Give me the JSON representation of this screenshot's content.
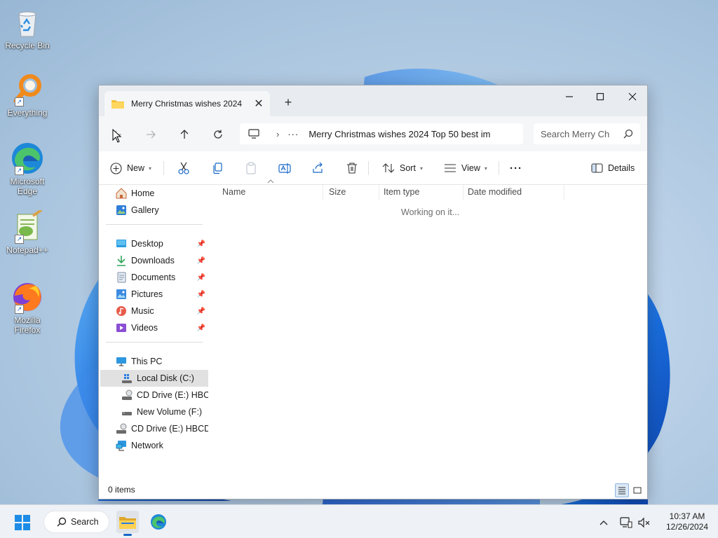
{
  "desktop": {
    "icons": [
      {
        "label": "Recycle Bin",
        "icon": "recycle-bin-icon"
      },
      {
        "label": "Everything",
        "icon": "everything-icon"
      },
      {
        "label": "Microsoft Edge",
        "icon": "edge-icon"
      },
      {
        "label": "Notepad++",
        "icon": "notepadpp-icon"
      },
      {
        "label": "Mozilla Firefox",
        "icon": "firefox-icon"
      }
    ]
  },
  "window": {
    "tab_title": "Merry Christmas wishes 2024",
    "new_tab_glyph": "+",
    "close_tab_glyph": "✕",
    "address": {
      "overflow": "···",
      "separator": "›",
      "path_visible": "Merry Christmas wishes 2024  Top 50 best im"
    },
    "search_placeholder": "Search Merry Ch",
    "commands": {
      "new": "New",
      "sort": "Sort",
      "view": "View",
      "more": "···",
      "details": "Details"
    },
    "nav": {
      "home": "Home",
      "gallery": "Gallery",
      "desktop": "Desktop",
      "downloads": "Downloads",
      "documents": "Documents",
      "pictures": "Pictures",
      "music": "Music",
      "videos": "Videos",
      "this_pc": "This PC",
      "local_disk": "Local Disk (C:)",
      "cd_drive_1": "CD Drive (E:) HBCD",
      "new_volume": "New Volume (F:)",
      "cd_drive_2": "CD Drive (E:) HBCD_F",
      "network": "Network",
      "pin_glyph": "📌"
    },
    "columns": {
      "name": "Name",
      "size": "Size",
      "item_type": "Item type",
      "date_modified": "Date modified"
    },
    "status_text": "Working on it...",
    "item_count": "0 items"
  },
  "taskbar": {
    "search_label": "Search",
    "time": "10:37 AM",
    "date": "12/26/2024"
  },
  "colors": {
    "accent": "#1767c8",
    "folder_yellow": "#f3c13a",
    "titlebar_bg": "#e8ecf0"
  }
}
